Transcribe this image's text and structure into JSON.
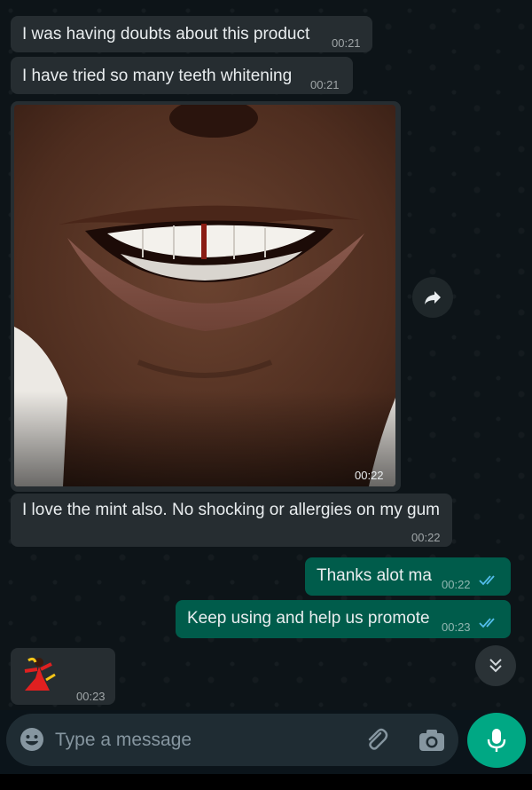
{
  "messages": [
    {
      "text": "I was having doubts about this product",
      "time": "00:21"
    },
    {
      "text": "I have tried so many teeth whitening",
      "time": "00:21"
    },
    {
      "image": "smile-photo",
      "time": "00:22"
    },
    {
      "text": "I love the mint also. No shocking or allergies on my gum",
      "time": "00:22"
    },
    {
      "text": "Thanks alot ma",
      "time": "00:22",
      "status": "read"
    },
    {
      "text": "Keep using and help us promote",
      "time": "00:23",
      "status": "read"
    },
    {
      "sticker": "dancing-lady-sticker",
      "time": "00:23"
    }
  ],
  "composer": {
    "placeholder": "Type a message"
  },
  "colors": {
    "incoming": "#262d31",
    "outgoing": "#005c4b",
    "accent": "#00a884",
    "read_ticks": "#53bdeb"
  },
  "icons": [
    "forward-icon",
    "scroll-down-icon",
    "emoji-icon",
    "attach-icon",
    "camera-icon",
    "mic-icon"
  ]
}
